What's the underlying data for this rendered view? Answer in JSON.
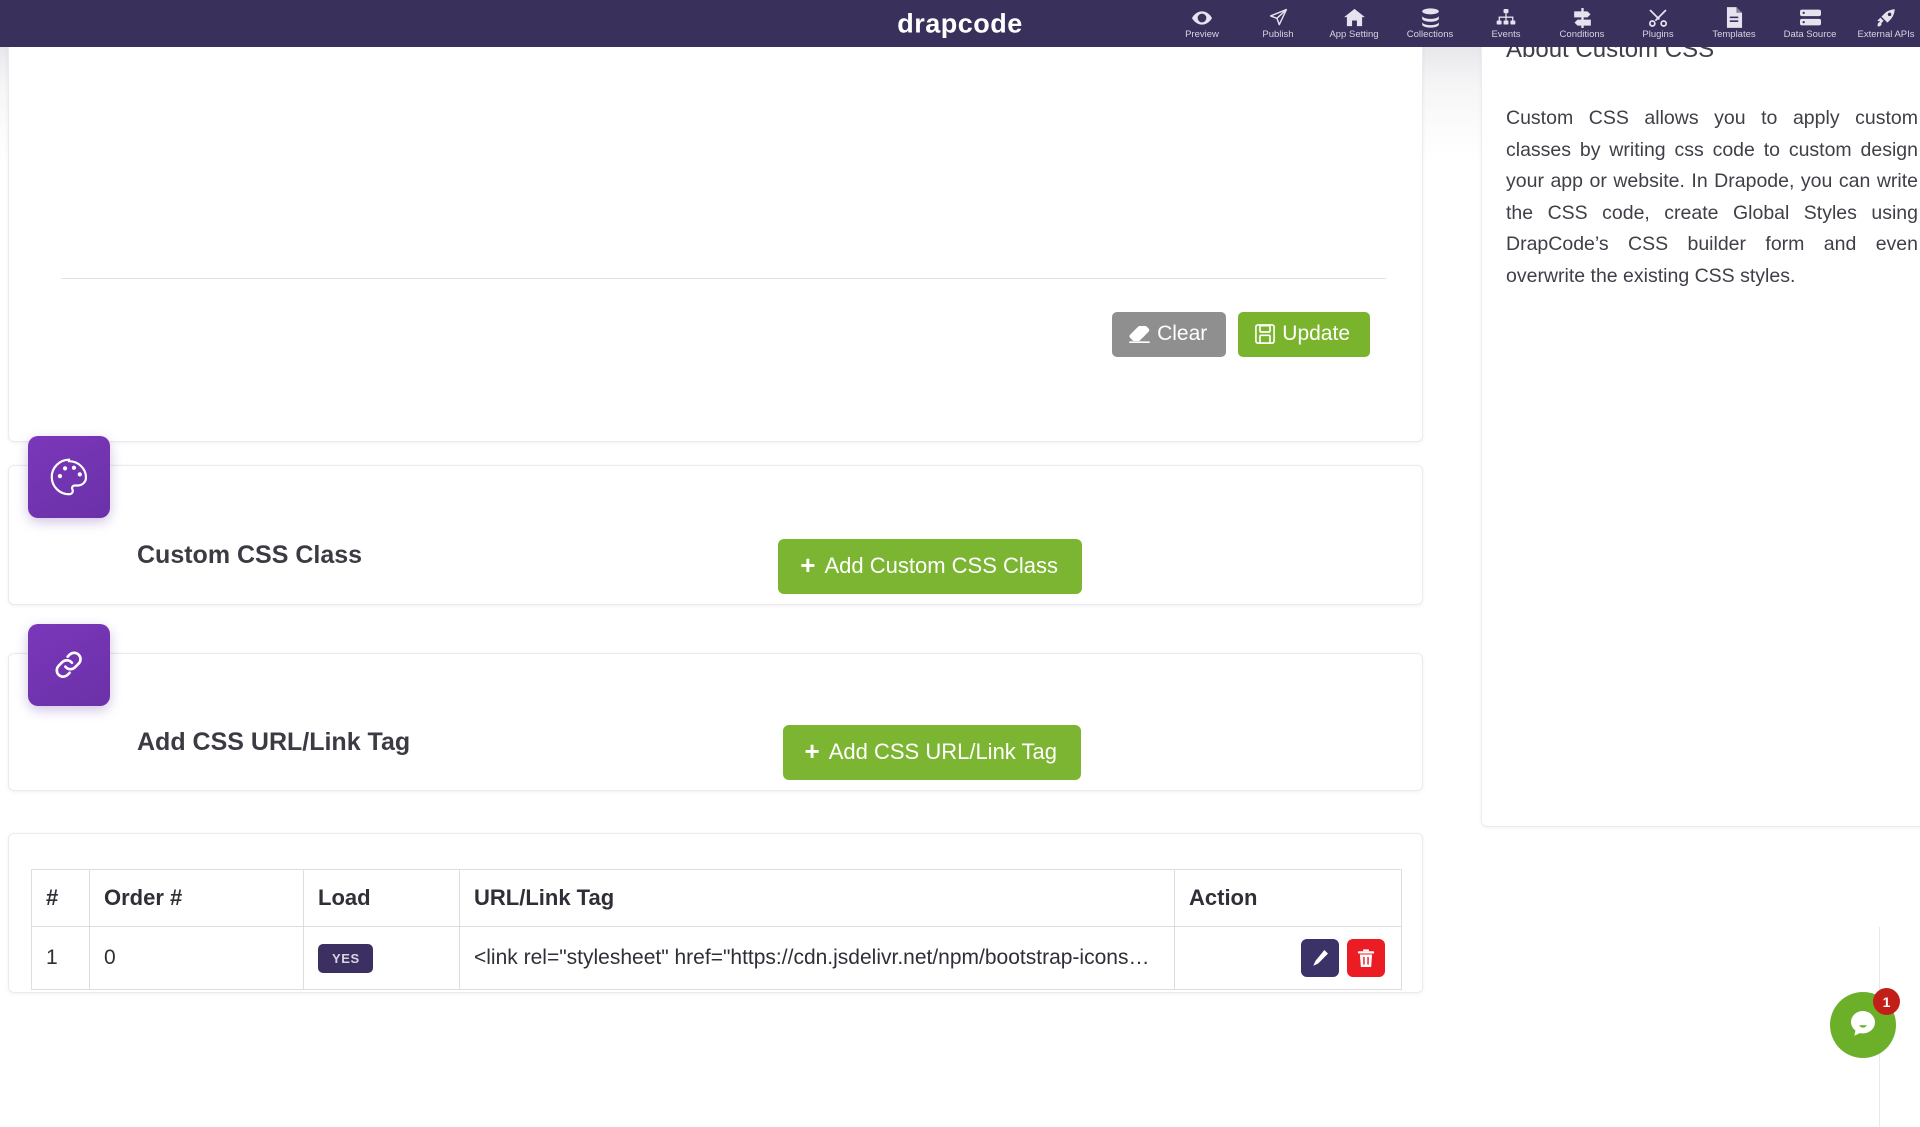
{
  "navbar": {
    "brand": "drapcode",
    "brand_color": "#39305c",
    "items": [
      {
        "label": "Preview",
        "icon": "eye-icon"
      },
      {
        "label": "Publish",
        "icon": "paper-plane-icon"
      },
      {
        "label": "App Setting",
        "icon": "home-icon"
      },
      {
        "label": "Collections",
        "icon": "database-icon"
      },
      {
        "label": "Events",
        "icon": "sitemap-icon"
      },
      {
        "label": "Conditions",
        "icon": "signpost-icon"
      },
      {
        "label": "Plugins",
        "icon": "tools-icon"
      },
      {
        "label": "Templates",
        "icon": "file-icon"
      },
      {
        "label": "Data Source",
        "icon": "server-icon"
      },
      {
        "label": "External APIs",
        "icon": "rocket-icon"
      }
    ]
  },
  "editor_card": {
    "clear_label": "Clear",
    "clear_icon": "eraser-icon",
    "clear_color": "#8f8f8f",
    "update_label": "Update",
    "update_icon": "save-icon",
    "update_color": "#79b42c"
  },
  "css_class_section": {
    "icon": "palette-icon",
    "title": "Custom CSS Class",
    "add_button_label": "Add Custom CSS Class"
  },
  "url_tag_section": {
    "icon": "link-icon",
    "title": "Add CSS URL/Link Tag",
    "add_button_label": "Add CSS URL/Link Tag"
  },
  "table": {
    "headers": [
      "#",
      "Order #",
      "Load",
      "URL/Link Tag",
      "Action"
    ],
    "rows": [
      {
        "num": "1",
        "order": "0",
        "load": "YES",
        "url": "<link rel=\"stylesheet\" href=\"https://cdn.jsdelivr.net/npm/bootstrap-icons@…",
        "edit_icon": "pencil-icon",
        "delete_icon": "trash-icon"
      }
    ]
  },
  "info_panel": {
    "title": "About Custom CSS",
    "body": "Custom CSS allows you to apply custom classes by writing css code to custom design your app or website. In Drapode, you can write the CSS code, create Global Styles using DrapCode’s CSS builder form and even overwrite the existing CSS styles."
  },
  "chat": {
    "icon": "chat-bubble-icon",
    "badge_count": "1",
    "color": "#6cb02a",
    "badge_color": "#c21f18"
  },
  "theme": {
    "accent_green": "#7cb531",
    "accent_purple": "#6b31a8",
    "navbar_bg": "#39305c",
    "danger_red": "#ec1c24"
  }
}
